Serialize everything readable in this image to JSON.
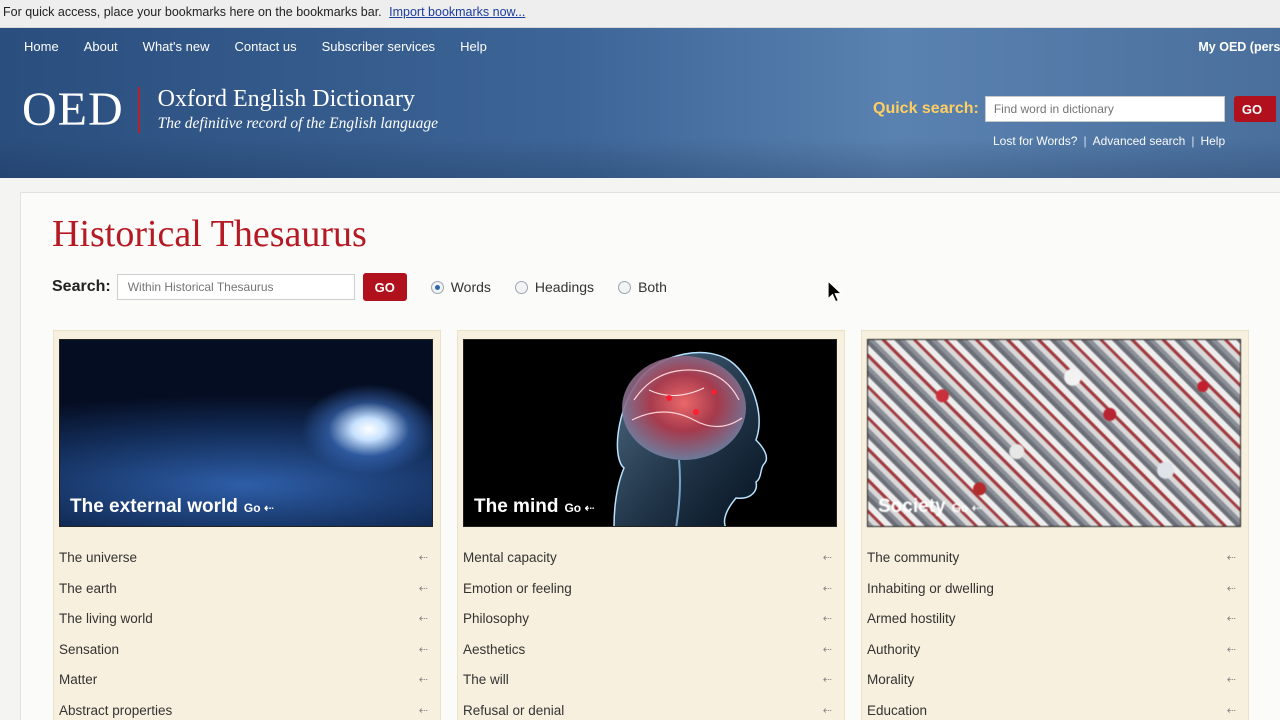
{
  "bookmarks_bar": {
    "text": "For quick access, place your bookmarks here on the bookmarks bar.",
    "import_link": "Import bookmarks now..."
  },
  "header": {
    "nav": [
      "Home",
      "About",
      "What's new",
      "Contact us",
      "Subscriber services",
      "Help"
    ],
    "my_oed": "My OED (perso",
    "logo_abbr": "OED",
    "logo_title": "Oxford English Dictionary",
    "logo_tagline": "The definitive record of the English language",
    "quick_search": {
      "label": "Quick search:",
      "placeholder": "Find word in dictionary",
      "go": "GO"
    },
    "links": [
      "Lost for Words?",
      "Advanced search",
      "Help"
    ]
  },
  "main": {
    "title": "Historical Thesaurus",
    "search": {
      "label": "Search:",
      "placeholder": "Within Historical Thesaurus",
      "go": "GO",
      "options": [
        {
          "label": "Words",
          "selected": true
        },
        {
          "label": "Headings",
          "selected": false
        },
        {
          "label": "Both",
          "selected": false
        }
      ]
    },
    "categories": [
      {
        "title": "The external world",
        "go": "Go",
        "items": [
          "The universe",
          "The earth",
          "The living world",
          "Sensation",
          "Matter",
          "Abstract properties"
        ]
      },
      {
        "title": "The mind",
        "go": "Go",
        "items": [
          "Mental capacity",
          "Emotion or feeling",
          "Philosophy",
          "Aesthetics",
          "The will",
          "Refusal or denial"
        ]
      },
      {
        "title": "Society",
        "go": "Go",
        "items": [
          "The community",
          "Inhabiting or dwelling",
          "Armed hostility",
          "Authority",
          "Morality",
          "Education"
        ]
      }
    ],
    "icons": {
      "link_arrow": "external-link-icon",
      "cursor": "mouse-pointer-icon"
    }
  }
}
